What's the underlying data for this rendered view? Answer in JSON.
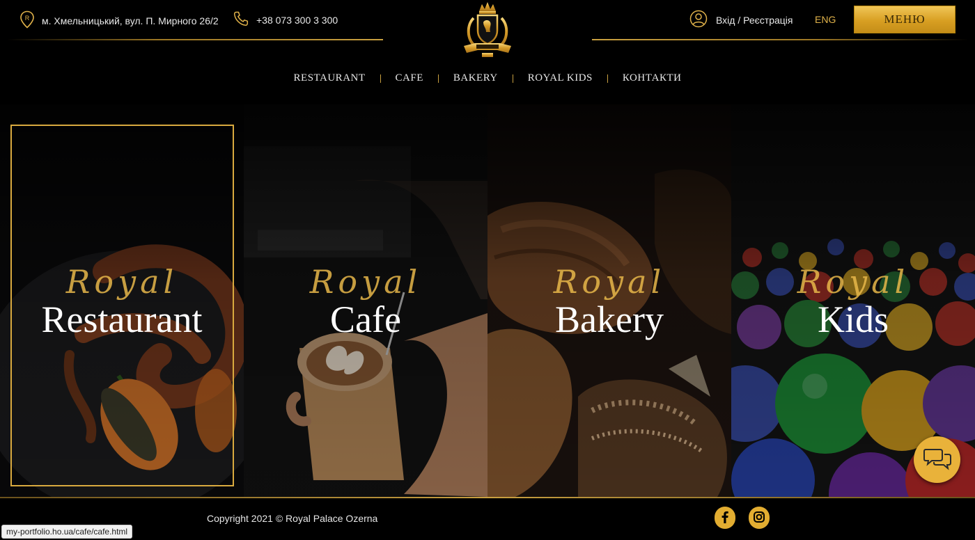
{
  "header": {
    "address": "м. Хмельницький, вул. П. Мирного 26/2",
    "phone": "+38 073 300 3 300",
    "login": "Вхід / Реєстрація",
    "lang": "ENG",
    "menu_button": "МЕНЮ"
  },
  "nav": {
    "items": [
      {
        "label": "RESTAURANT"
      },
      {
        "label": "CAFE"
      },
      {
        "label": "BAKERY"
      },
      {
        "label": "ROYAL KIDS"
      },
      {
        "label": "КОНТАКТИ"
      }
    ]
  },
  "panels": [
    {
      "script": "Royal",
      "title": "Restaurant"
    },
    {
      "script": "Royal",
      "title": "Cafe"
    },
    {
      "script": "Royal",
      "title": "Bakery"
    },
    {
      "script": "Royal",
      "title": "Kids"
    }
  ],
  "footer": {
    "copyright": "Copyright 2021 © Royal Palace Ozerna"
  },
  "status_bar": {
    "url": "my-portfolio.ho.ua/cafe/cafe.html"
  },
  "icons": {
    "address": "location-pin-icon",
    "phone": "phone-icon",
    "login": "user-icon",
    "facebook": "facebook-icon",
    "instagram": "instagram-icon",
    "chat": "chat-icon"
  },
  "colors": {
    "accent_gold": "#e0b24a",
    "background": "#000000"
  }
}
